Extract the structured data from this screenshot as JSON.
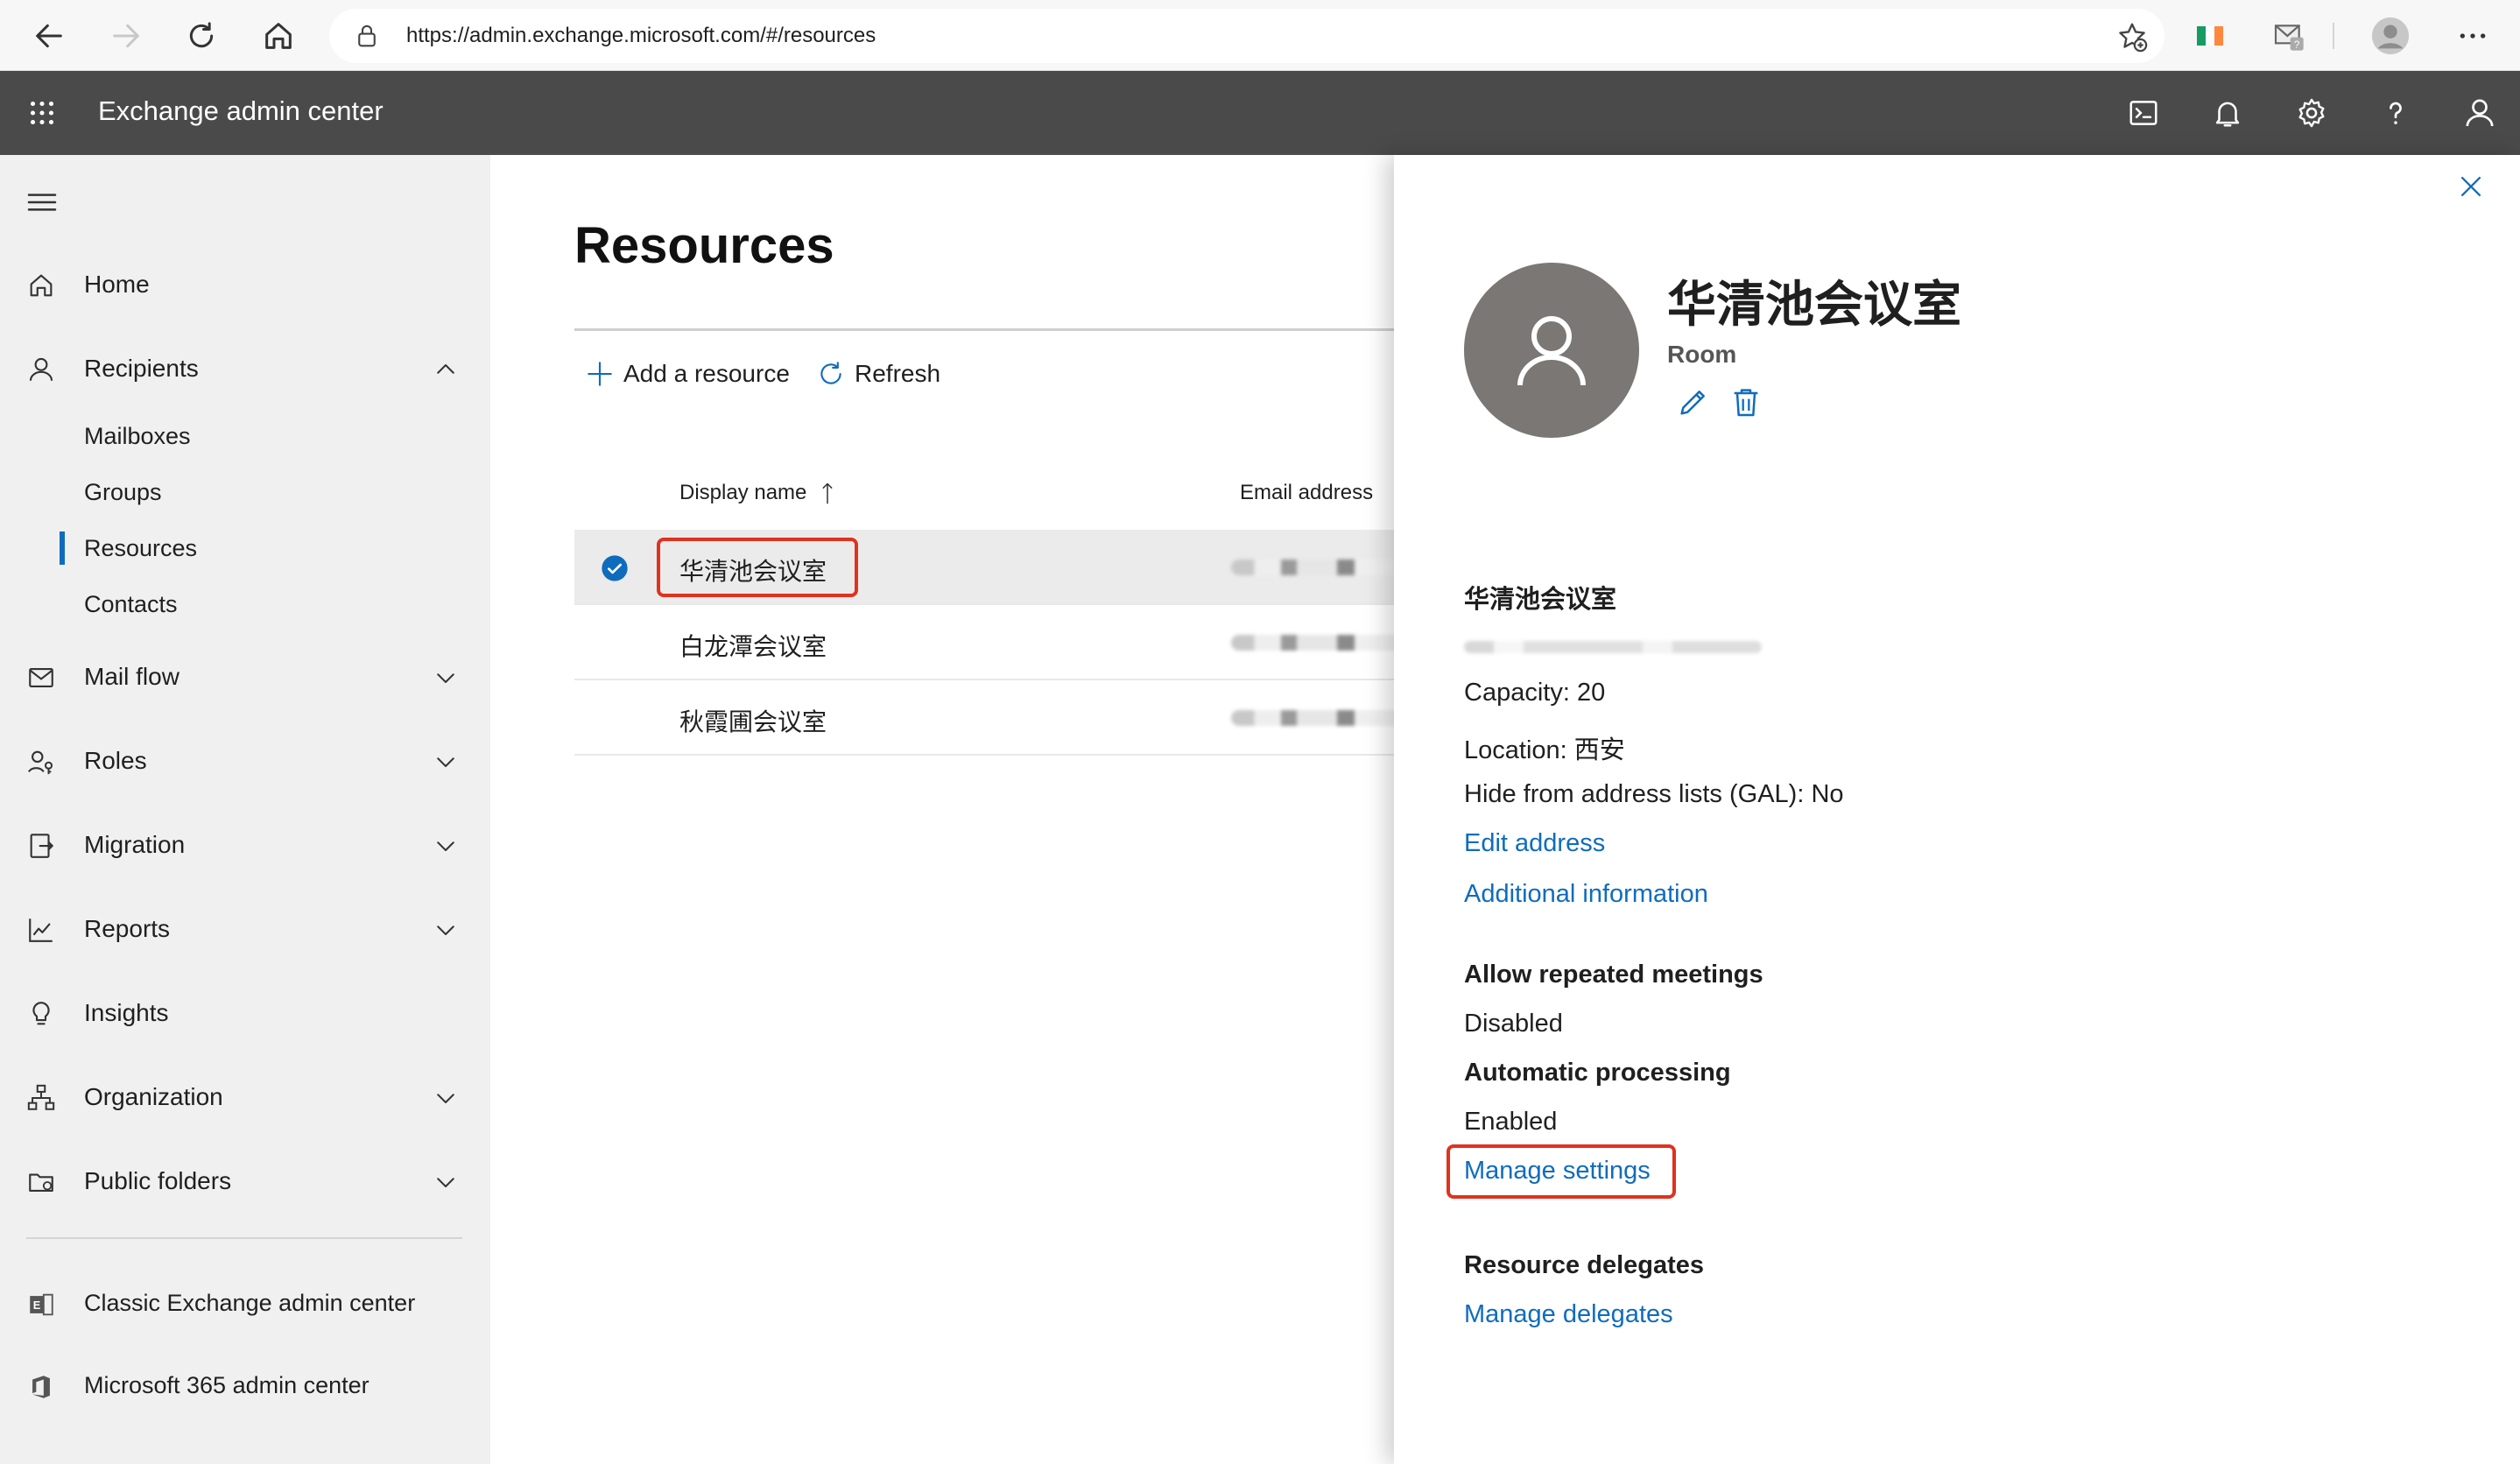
{
  "browser": {
    "url": "https://admin.exchange.microsoft.com/#/resources"
  },
  "app": {
    "title": "Exchange admin center"
  },
  "sidebar": {
    "items": [
      {
        "label": "Home",
        "icon": "home-icon"
      },
      {
        "label": "Recipients",
        "icon": "person-icon",
        "expanded": true
      },
      {
        "label": "Mail flow",
        "icon": "mail-icon"
      },
      {
        "label": "Roles",
        "icon": "roles-icon"
      },
      {
        "label": "Migration",
        "icon": "migration-icon"
      },
      {
        "label": "Reports",
        "icon": "chart-icon"
      },
      {
        "label": "Insights",
        "icon": "lightbulb-icon"
      },
      {
        "label": "Organization",
        "icon": "org-icon"
      },
      {
        "label": "Public folders",
        "icon": "folder-icon"
      }
    ],
    "recipients_sub": [
      {
        "label": "Mailboxes"
      },
      {
        "label": "Groups"
      },
      {
        "label": "Resources",
        "selected": true
      },
      {
        "label": "Contacts"
      }
    ],
    "bottom_links": [
      {
        "label": "Classic Exchange admin center"
      },
      {
        "label": "Microsoft 365 admin center"
      }
    ]
  },
  "main": {
    "title": "Resources",
    "toolbar": {
      "add_label": "Add a resource",
      "refresh_label": "Refresh"
    },
    "columns": {
      "display_name": "Display name",
      "email": "Email address"
    },
    "rows": [
      {
        "name": "华清池会议室",
        "selected": true
      },
      {
        "name": "白龙潭会议室",
        "selected": false
      },
      {
        "name": "秋霞圃会议室",
        "selected": false
      }
    ]
  },
  "panel": {
    "name": "华清池会议室",
    "type": "Room",
    "section_name": "华清池会议室",
    "capacity": "Capacity: 20",
    "location": "Location: 西安",
    "hide_gal": "Hide from address lists (GAL): No",
    "edit_address": "Edit address",
    "additional_info": "Additional information",
    "repeated_heading": "Allow repeated meetings",
    "repeated_value": "Disabled",
    "auto_heading": "Automatic processing",
    "auto_value": "Enabled",
    "manage_settings": "Manage settings",
    "delegates_heading": "Resource delegates",
    "manage_delegates": "Manage delegates"
  },
  "colors": {
    "header_bg": "#4a4a4a",
    "sidebar_bg": "#f0f0f0",
    "accent": "#0f6cbd",
    "highlight": "#e0321f",
    "avatar_bg": "#7a7774"
  }
}
